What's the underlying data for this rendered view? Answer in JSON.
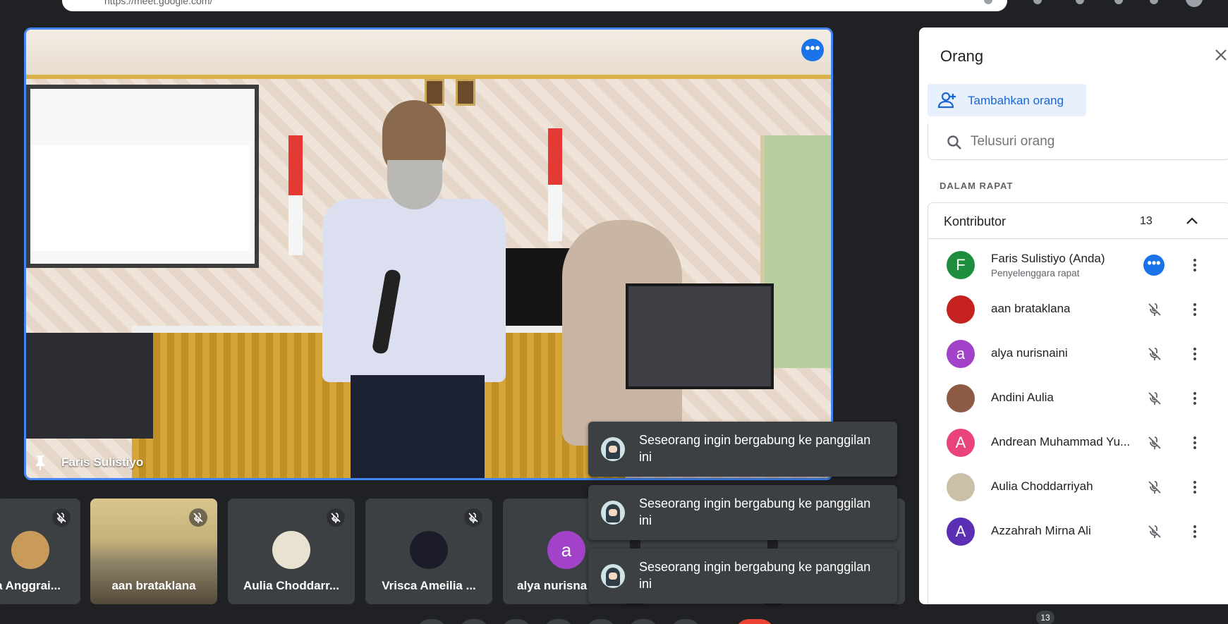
{
  "browser": {
    "url": "https://meet.google.com/"
  },
  "main_video": {
    "participant_name": "Faris Sulistiyo",
    "more_label": "•••"
  },
  "tiles": [
    {
      "name": "a Anggrai...",
      "avatar": ""
    },
    {
      "name": "aan brataklana",
      "avatar": ""
    },
    {
      "name": "Aulia Choddarr...",
      "avatar": ""
    },
    {
      "name": "Vrisca Ameilia ...",
      "avatar": ""
    },
    {
      "name": "alya nurisna",
      "avatar": "a"
    }
  ],
  "toasts": [
    {
      "text": "Seseorang ingin bergabung ke panggilan ini"
    },
    {
      "text": "Seseorang ingin bergabung ke panggilan ini"
    },
    {
      "text": "Seseorang ingin bergabung ke panggilan ini"
    }
  ],
  "panel": {
    "title": "Orang",
    "add_label": "Tambahkan orang",
    "search_placeholder": "Telusuri orang",
    "section_label": "DALAM RAPAT",
    "group_label": "Kontributor",
    "group_count": "13",
    "people": [
      {
        "name": "Faris Sulistiyo (Anda)",
        "sub": "Penyelenggara rapat",
        "avatar": "F",
        "color": "#1e8e3e"
      },
      {
        "name": "aan brataklana",
        "sub": "",
        "avatar": "",
        "color": "#c5221f"
      },
      {
        "name": "alya nurisnaini",
        "sub": "",
        "avatar": "a",
        "color": "#a142c9"
      },
      {
        "name": "Andini Aulia",
        "sub": "",
        "avatar": "",
        "color": "#8d5a45"
      },
      {
        "name": "Andrean Muhammad Yu...",
        "sub": "",
        "avatar": "A",
        "color": "#e8437a"
      },
      {
        "name": "Aulia Choddarriyah",
        "sub": "",
        "avatar": "",
        "color": "#cbbfa8"
      },
      {
        "name": "Azzahrah Mirna Ali",
        "sub": "",
        "avatar": "A",
        "color": "#5b2fb3"
      }
    ]
  },
  "bottom": {
    "participant_badge": "13"
  },
  "colors": {
    "accent": "#1a73e8",
    "background": "#202124",
    "tile": "#3c4043"
  }
}
